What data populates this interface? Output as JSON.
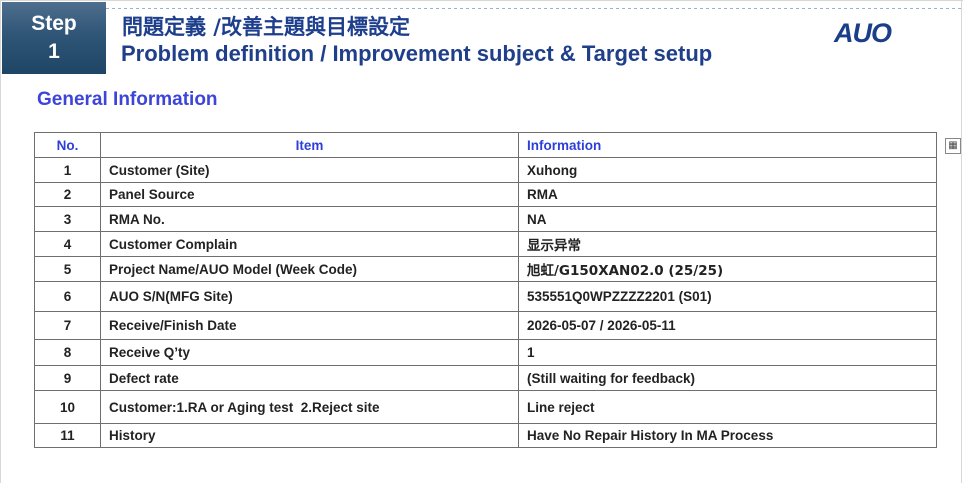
{
  "header": {
    "step_label": "Step",
    "step_number": "1",
    "title_zh": "問題定義 /改善主題與目標設定",
    "title_en": "Problem definition / Improvement subject & Target setup",
    "logo_text": "AUO"
  },
  "section": {
    "title": "General Information"
  },
  "side_icon_glyph": "▦",
  "table": {
    "columns": [
      "No.",
      "Item",
      "Information"
    ],
    "rows": [
      {
        "no": "1",
        "item": "Customer (Site)",
        "info": "Xuhong"
      },
      {
        "no": "2",
        "item": "Panel Source",
        "info": "RMA"
      },
      {
        "no": "3",
        "item": "RMA No.",
        "info": "NA"
      },
      {
        "no": "4",
        "item": "Customer Complain",
        "info": "显示异常"
      },
      {
        "no": "5",
        "item": "Project Name/AUO Model (Week Code)",
        "info": "旭虹/G150XAN02.0 (25/25)"
      },
      {
        "no": "6",
        "item": "AUO S/N(MFG Site)",
        "info": "535551Q0WPZZZZ2201 (S01)"
      },
      {
        "no": "7",
        "item": "Receive/Finish Date",
        "info": "2026-05-07 / 2026-05-11"
      },
      {
        "no": "8",
        "item": "Receive Q’ty",
        "info": "1"
      },
      {
        "no": "9",
        "item": "Defect rate",
        "info": "(Still waiting for feedback)"
      },
      {
        "no": "10",
        "item": "Customer:1.RA or Aging test  2.Reject site",
        "info": "Line reject"
      },
      {
        "no": "11",
        "item": "History",
        "info": "Have No Repair History In MA Process"
      }
    ]
  },
  "colors": {
    "title_blue": "#1d3e8c",
    "section_blue": "#3d45d8",
    "header_blue": "#2d3fd9",
    "step_box": "#2f5577"
  }
}
